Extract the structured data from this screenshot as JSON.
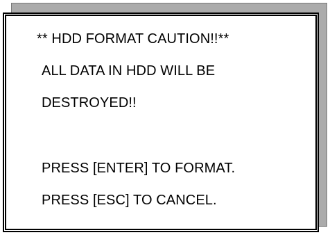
{
  "dialog": {
    "title": "** HDD FORMAT CAUTION!!**",
    "warning_line_1": "ALL DATA IN HDD WILL BE",
    "warning_line_2": "DESTROYED!!",
    "instruction_format": "PRESS [ENTER] TO FORMAT.",
    "instruction_cancel": "PRESS [ESC] TO CANCEL."
  },
  "colors": {
    "background": "#ffffff",
    "text": "#000000",
    "shadow": "#ababab"
  }
}
